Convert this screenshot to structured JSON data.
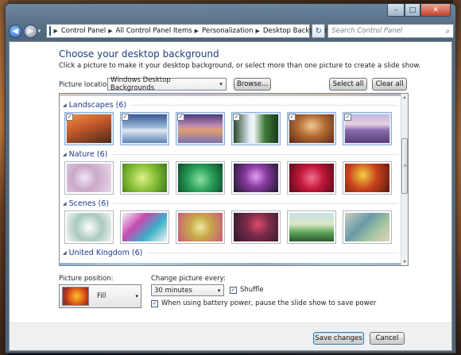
{
  "window": {
    "caption": {
      "minimize": "–",
      "maximize": "□",
      "close": "✕"
    }
  },
  "nav": {
    "back_icon": "◀",
    "forward_icon": "▶",
    "history_dropdown": "▾",
    "breadcrumbs": [
      "Control Panel",
      "All Control Panel Items",
      "Personalization",
      "Desktop Background"
    ],
    "breadcrumb_separator": "▶",
    "address_dropdown": "▾",
    "refresh_icon": "↻",
    "search_placeholder": "Search Control Panel",
    "search_icon": "⌕"
  },
  "header": {
    "title": "Choose your desktop background",
    "subtitle": "Click a picture to make it your desktop background, or select more than one picture to create a slide show."
  },
  "location": {
    "label": "Picture location:",
    "value": "Windows Desktop Backgrounds",
    "dropdown_icon": "▾",
    "browse": "Browse...",
    "select_all": "Select all",
    "clear_all": "Clear all"
  },
  "gallery": {
    "collapse_icon": "◢",
    "groups": [
      {
        "title": "Landscapes (6)",
        "selected": true,
        "check": "✓",
        "thumbs": [
          "#c0572a",
          "#5b84b8",
          "#7a6fb0",
          "#3f7a3a",
          "#b06a32",
          "#8a6fb0"
        ]
      },
      {
        "title": "Nature (6)",
        "selected": false,
        "thumbs": [
          "#c9a8c8",
          "#8cc23a",
          "#2aa05a",
          "#8a3aa0",
          "#c2183a",
          "#c8421e"
        ]
      },
      {
        "title": "Scenes (6)",
        "selected": false,
        "thumbs": [
          "#a9c9c0",
          "#c84ab0",
          "#c8a84a",
          "#7a2a4a",
          "#5aa05a",
          "#6a9aa8"
        ]
      },
      {
        "title": "United Kingdom (6)",
        "selected": false,
        "thumbs": []
      }
    ],
    "scroll_up": "▴",
    "scroll_down": "▾",
    "scroll_grip": "≡"
  },
  "position": {
    "label": "Picture position:",
    "value": "Fill",
    "dropdown_icon": "▾"
  },
  "change": {
    "label": "Change picture every:",
    "value": "30 minutes",
    "dropdown_icon": "▾",
    "shuffle_label": "Shuffle",
    "shuffle_checked": "✓",
    "battery_label": "When using battery power, pause the slide show to save power",
    "battery_checked": "✓"
  },
  "footer": {
    "save": "Save changes",
    "cancel": "Cancel"
  }
}
